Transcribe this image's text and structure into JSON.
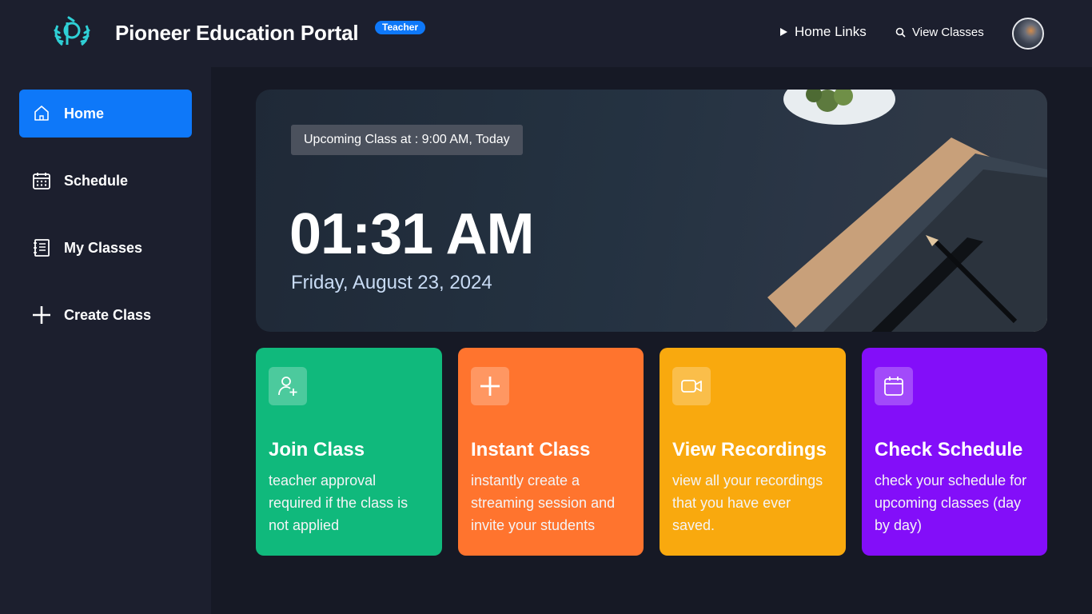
{
  "header": {
    "brand": "Pioneer Education Portal",
    "role_badge": "Teacher",
    "nav": [
      {
        "label": "Home Links",
        "icon": "play-icon"
      },
      {
        "label": "View Classes",
        "icon": "search-icon"
      }
    ],
    "avatar_icon": "user-avatar"
  },
  "sidebar": {
    "items": [
      {
        "label": "Home",
        "icon": "home-icon",
        "active": true
      },
      {
        "label": "Schedule",
        "icon": "calendar-icon",
        "active": false
      },
      {
        "label": "My Classes",
        "icon": "notebook-icon",
        "active": false
      },
      {
        "label": "Create Class",
        "icon": "plus-icon",
        "active": false
      }
    ]
  },
  "hero": {
    "upcoming": "Upcoming Class at : 9:00 AM, Today",
    "time": "01:31 AM",
    "date": "Friday, August 23, 2024"
  },
  "cards": [
    {
      "title": "Join Class",
      "desc": "teacher approval required if the class is not applied",
      "icon": "user-plus-icon",
      "color": "#10b97c"
    },
    {
      "title": "Instant Class",
      "desc": "instantly create a streaming session and invite your students",
      "icon": "plus-icon",
      "color": "#ff742e"
    },
    {
      "title": "View Recordings",
      "desc": "view all your recordings that you have ever saved.",
      "icon": "video-camera-icon",
      "color": "#f9a90e"
    },
    {
      "title": "Check Schedule",
      "desc": "check your schedule for upcoming classes (day by day)",
      "icon": "calendar-icon",
      "color": "#830ef9"
    }
  ],
  "colors": {
    "background": "#1c1f2e",
    "accent": "#0e78f9"
  }
}
